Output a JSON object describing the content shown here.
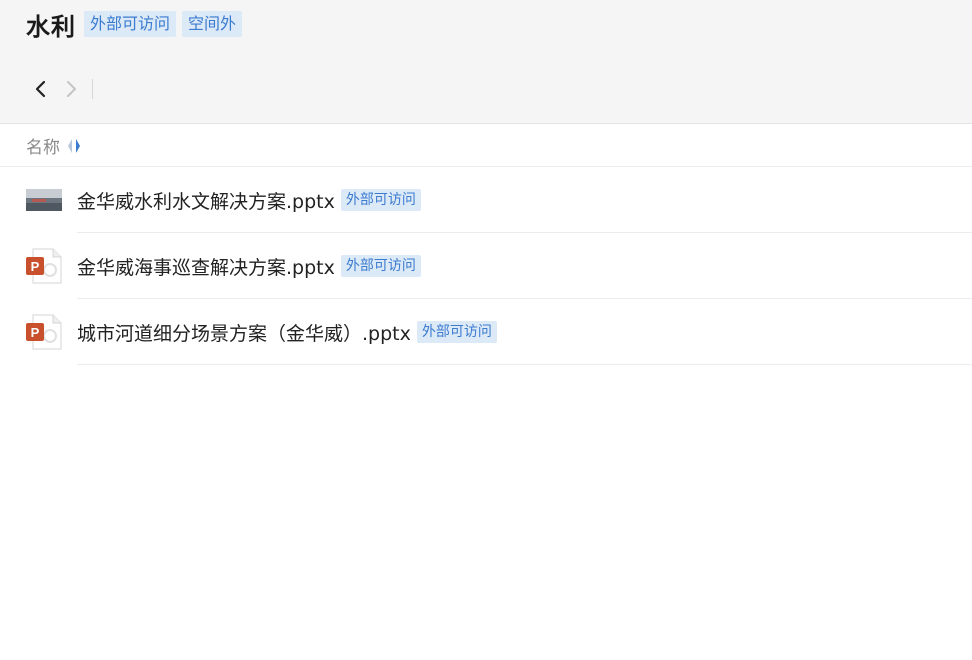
{
  "header": {
    "title": "水利",
    "tags": [
      "外部可访问",
      "空间外"
    ]
  },
  "nav": {
    "back_icon": "chevron-left-icon",
    "forward_icon": "chevron-right-icon"
  },
  "columns": {
    "name_label": "名称",
    "sort_icon": "sort-icon"
  },
  "files": [
    {
      "name": "金华威水利水文解决方案.pptx",
      "tag": "外部可访问",
      "icon": "image-thumbnail-icon"
    },
    {
      "name": "金华威海事巡查解决方案.pptx",
      "tag": "外部可访问",
      "icon": "powerpoint-file-icon"
    },
    {
      "name": "城市河道细分场景方案（金华威）.pptx",
      "tag": "外部可访问",
      "icon": "powerpoint-file-icon"
    }
  ],
  "colors": {
    "tag_bg": "#dce9f7",
    "tag_text": "#3b7bd0",
    "ppt_orange": "#c9502c"
  }
}
